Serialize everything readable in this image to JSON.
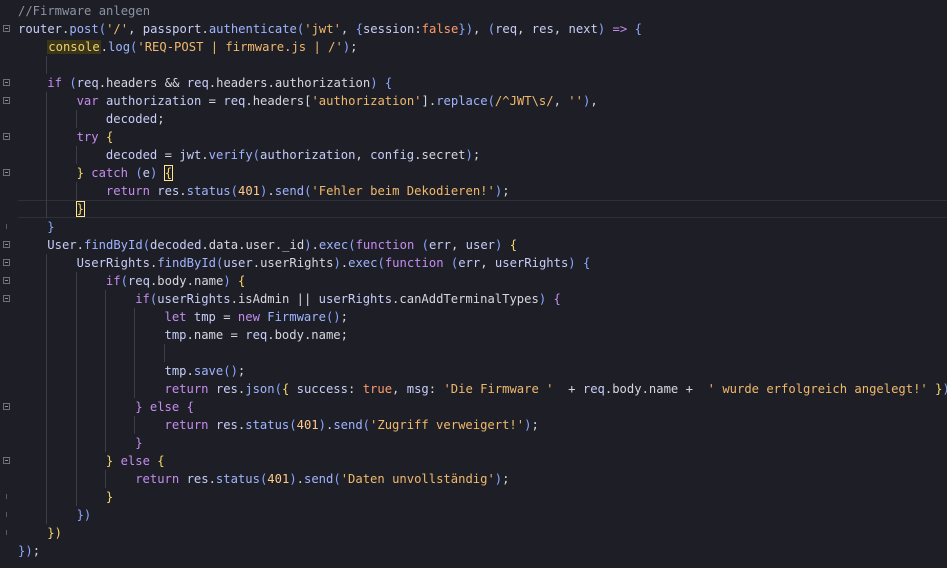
{
  "editor": {
    "theme": {
      "background": "#1e1f26",
      "comment": "#8b93a3",
      "string": "#f0b86d",
      "keyword": "#c58cf0",
      "function": "#9fb4ff",
      "variable": "#c6cdf7"
    },
    "lines": [
      {
        "indent": 0,
        "tokens": [
          [
            "comment",
            "//Firmware anlegen"
          ]
        ]
      },
      {
        "indent": 0,
        "fold": true,
        "tokens": [
          [
            "var",
            "router"
          ],
          [
            "punc",
            "."
          ],
          [
            "fn",
            "post"
          ],
          [
            "paren",
            "("
          ],
          [
            "str",
            "'/'"
          ],
          [
            "punc",
            ", "
          ],
          [
            "var",
            "passport"
          ],
          [
            "punc",
            "."
          ],
          [
            "fn",
            "authenticate"
          ],
          [
            "paren",
            "("
          ],
          [
            "str",
            "'jwt'"
          ],
          [
            "punc",
            ", "
          ],
          [
            "paren",
            "{"
          ],
          [
            "var",
            "session"
          ],
          [
            "punc",
            ":"
          ],
          [
            "bool",
            "false"
          ],
          [
            "paren",
            "}"
          ],
          [
            "paren",
            ")"
          ],
          [
            "punc",
            ", "
          ],
          [
            "paren",
            "("
          ],
          [
            "var",
            "req"
          ],
          [
            "punc",
            ", "
          ],
          [
            "var",
            "res"
          ],
          [
            "punc",
            ", "
          ],
          [
            "var",
            "next"
          ],
          [
            "paren",
            ")"
          ],
          [
            "punc",
            " "
          ],
          [
            "kw",
            "=>"
          ],
          [
            "punc",
            " "
          ],
          [
            "paren",
            "{"
          ]
        ]
      },
      {
        "indent": 1,
        "tokens": [
          [
            "console",
            "console"
          ],
          [
            "punc",
            "."
          ],
          [
            "fn",
            "log"
          ],
          [
            "paren",
            "("
          ],
          [
            "str",
            "'REQ-POST | firmware.js | /'"
          ],
          [
            "paren",
            ")"
          ],
          [
            "punc",
            ";"
          ]
        ]
      },
      {
        "indent": 1,
        "tokens": []
      },
      {
        "indent": 1,
        "fold": true,
        "tokens": [
          [
            "kw",
            "if"
          ],
          [
            "punc",
            " "
          ],
          [
            "paren",
            "("
          ],
          [
            "var",
            "req"
          ],
          [
            "punc",
            "."
          ],
          [
            "prop",
            "headers"
          ],
          [
            "punc",
            " && "
          ],
          [
            "var",
            "req"
          ],
          [
            "punc",
            "."
          ],
          [
            "prop",
            "headers"
          ],
          [
            "punc",
            "."
          ],
          [
            "prop",
            "authorization"
          ],
          [
            "paren",
            ")"
          ],
          [
            "punc",
            " "
          ],
          [
            "paren",
            "{"
          ]
        ]
      },
      {
        "indent": 2,
        "fold": true,
        "tokens": [
          [
            "kw",
            "var"
          ],
          [
            "punc",
            " "
          ],
          [
            "var",
            "authorization"
          ],
          [
            "punc",
            " = "
          ],
          [
            "var",
            "req"
          ],
          [
            "punc",
            "."
          ],
          [
            "prop",
            "headers"
          ],
          [
            "punc",
            "["
          ],
          [
            "str",
            "'authorization'"
          ],
          [
            "punc",
            "]."
          ],
          [
            "fn",
            "replace"
          ],
          [
            "paren",
            "("
          ],
          [
            "str",
            "/^JWT\\s/"
          ],
          [
            "punc",
            ", "
          ],
          [
            "str",
            "''"
          ],
          [
            "paren",
            ")"
          ],
          [
            "punc",
            ","
          ]
        ]
      },
      {
        "indent": 3,
        "tokens": [
          [
            "var",
            "decoded"
          ],
          [
            "punc",
            ";"
          ]
        ]
      },
      {
        "indent": 2,
        "fold": true,
        "tokens": [
          [
            "kw",
            "try"
          ],
          [
            "punc",
            " "
          ],
          [
            "ok",
            "{"
          ]
        ]
      },
      {
        "indent": 3,
        "tokens": [
          [
            "var",
            "decoded"
          ],
          [
            "punc",
            " = "
          ],
          [
            "var",
            "jwt"
          ],
          [
            "punc",
            "."
          ],
          [
            "fn",
            "verify"
          ],
          [
            "paren",
            "("
          ],
          [
            "var",
            "authorization"
          ],
          [
            "punc",
            ", "
          ],
          [
            "var",
            "config"
          ],
          [
            "punc",
            "."
          ],
          [
            "prop",
            "secret"
          ],
          [
            "paren",
            ")"
          ],
          [
            "punc",
            ";"
          ]
        ]
      },
      {
        "indent": 2,
        "fold": true,
        "tokens": [
          [
            "ok",
            "}"
          ],
          [
            "punc",
            " "
          ],
          [
            "kw",
            "catch"
          ],
          [
            "punc",
            " "
          ],
          [
            "paren",
            "("
          ],
          [
            "var",
            "e"
          ],
          [
            "paren",
            ")"
          ],
          [
            "punc",
            " "
          ],
          [
            "hl",
            "{"
          ]
        ]
      },
      {
        "indent": 3,
        "tokens": [
          [
            "kw",
            "return"
          ],
          [
            "punc",
            " "
          ],
          [
            "var",
            "res"
          ],
          [
            "punc",
            "."
          ],
          [
            "fn",
            "status"
          ],
          [
            "paren",
            "("
          ],
          [
            "num",
            "401"
          ],
          [
            "paren",
            ")"
          ],
          [
            "punc",
            "."
          ],
          [
            "fn",
            "send"
          ],
          [
            "paren",
            "("
          ],
          [
            "str",
            "'Fehler beim Dekodieren!'"
          ],
          [
            "paren",
            ")"
          ],
          [
            "punc",
            ";"
          ]
        ]
      },
      {
        "indent": 2,
        "cursor": true,
        "tokens": [
          [
            "hl",
            "}"
          ]
        ]
      },
      {
        "indent": 1,
        "tokens": [
          [
            "paren",
            "}"
          ]
        ]
      },
      {
        "indent": 1,
        "fold": true,
        "tokens": [
          [
            "var",
            "User"
          ],
          [
            "punc",
            "."
          ],
          [
            "fn",
            "findById"
          ],
          [
            "paren",
            "("
          ],
          [
            "var",
            "decoded"
          ],
          [
            "punc",
            "."
          ],
          [
            "prop",
            "data"
          ],
          [
            "punc",
            "."
          ],
          [
            "prop",
            "user"
          ],
          [
            "punc",
            "."
          ],
          [
            "prop",
            "_id"
          ],
          [
            "paren",
            ")"
          ],
          [
            "punc",
            "."
          ],
          [
            "fn",
            "exec"
          ],
          [
            "paren",
            "("
          ],
          [
            "kw",
            "function"
          ],
          [
            "punc",
            " "
          ],
          [
            "paren",
            "("
          ],
          [
            "var",
            "err"
          ],
          [
            "punc",
            ", "
          ],
          [
            "var",
            "user"
          ],
          [
            "paren",
            ")"
          ],
          [
            "punc",
            " "
          ],
          [
            "ok",
            "{"
          ]
        ]
      },
      {
        "indent": 2,
        "fold": true,
        "tokens": [
          [
            "var",
            "UserRights"
          ],
          [
            "punc",
            "."
          ],
          [
            "fn",
            "findById"
          ],
          [
            "paren",
            "("
          ],
          [
            "var",
            "user"
          ],
          [
            "punc",
            "."
          ],
          [
            "prop",
            "userRights"
          ],
          [
            "paren",
            ")"
          ],
          [
            "punc",
            "."
          ],
          [
            "fn",
            "exec"
          ],
          [
            "paren",
            "("
          ],
          [
            "kw",
            "function"
          ],
          [
            "punc",
            " "
          ],
          [
            "paren",
            "("
          ],
          [
            "var",
            "err"
          ],
          [
            "punc",
            ", "
          ],
          [
            "var",
            "userRights"
          ],
          [
            "paren",
            ")"
          ],
          [
            "punc",
            " "
          ],
          [
            "paren",
            "{"
          ]
        ]
      },
      {
        "indent": 3,
        "fold": true,
        "tokens": [
          [
            "kw",
            "if"
          ],
          [
            "paren",
            "("
          ],
          [
            "var",
            "req"
          ],
          [
            "punc",
            "."
          ],
          [
            "prop",
            "body"
          ],
          [
            "punc",
            "."
          ],
          [
            "prop",
            "name"
          ],
          [
            "paren",
            ")"
          ],
          [
            "punc",
            " "
          ],
          [
            "ok",
            "{"
          ]
        ]
      },
      {
        "indent": 4,
        "fold": true,
        "tokens": [
          [
            "kw",
            "if"
          ],
          [
            "paren",
            "("
          ],
          [
            "var",
            "userRights"
          ],
          [
            "punc",
            "."
          ],
          [
            "prop",
            "isAdmin"
          ],
          [
            "punc",
            " || "
          ],
          [
            "var",
            "userRights"
          ],
          [
            "punc",
            "."
          ],
          [
            "prop",
            "canAddTerminalTypes"
          ],
          [
            "paren",
            ")"
          ],
          [
            "punc",
            " "
          ],
          [
            "kw",
            "{"
          ]
        ]
      },
      {
        "indent": 5,
        "tokens": [
          [
            "kw",
            "let"
          ],
          [
            "punc",
            " "
          ],
          [
            "var",
            "tmp"
          ],
          [
            "punc",
            " = "
          ],
          [
            "kw",
            "new"
          ],
          [
            "punc",
            " "
          ],
          [
            "fn",
            "Firmware"
          ],
          [
            "paren",
            "("
          ],
          [
            "paren",
            ")"
          ],
          [
            "punc",
            ";"
          ]
        ]
      },
      {
        "indent": 5,
        "tokens": [
          [
            "var",
            "tmp"
          ],
          [
            "punc",
            "."
          ],
          [
            "prop",
            "name"
          ],
          [
            "punc",
            " = "
          ],
          [
            "var",
            "req"
          ],
          [
            "punc",
            "."
          ],
          [
            "prop",
            "body"
          ],
          [
            "punc",
            "."
          ],
          [
            "prop",
            "name"
          ],
          [
            "punc",
            ";"
          ]
        ]
      },
      {
        "indent": 5,
        "tokens": []
      },
      {
        "indent": 5,
        "tokens": [
          [
            "var",
            "tmp"
          ],
          [
            "punc",
            "."
          ],
          [
            "fn",
            "save"
          ],
          [
            "paren",
            "("
          ],
          [
            "paren",
            ")"
          ],
          [
            "punc",
            ";"
          ]
        ]
      },
      {
        "indent": 5,
        "tokens": [
          [
            "kw",
            "return"
          ],
          [
            "punc",
            " "
          ],
          [
            "var",
            "res"
          ],
          [
            "punc",
            "."
          ],
          [
            "fn",
            "json"
          ],
          [
            "paren",
            "("
          ],
          [
            "ok",
            "{"
          ],
          [
            "punc",
            " "
          ],
          [
            "var",
            "success"
          ],
          [
            "punc",
            ": "
          ],
          [
            "bool",
            "true"
          ],
          [
            "punc",
            ", "
          ],
          [
            "var",
            "msg"
          ],
          [
            "punc",
            ": "
          ],
          [
            "str",
            "'Die Firmware '"
          ],
          [
            "punc",
            "  + "
          ],
          [
            "var",
            "req"
          ],
          [
            "punc",
            "."
          ],
          [
            "prop",
            "body"
          ],
          [
            "punc",
            "."
          ],
          [
            "prop",
            "name"
          ],
          [
            "punc",
            " +  "
          ],
          [
            "str",
            "' wurde erfolgreich angelegt!'"
          ],
          [
            "punc",
            " "
          ],
          [
            "ok",
            "}"
          ],
          [
            "paren",
            ")"
          ],
          [
            "punc",
            ";"
          ]
        ]
      },
      {
        "indent": 4,
        "fold": true,
        "tokens": [
          [
            "kw",
            "}"
          ],
          [
            "punc",
            " "
          ],
          [
            "kw",
            "else"
          ],
          [
            "punc",
            " "
          ],
          [
            "kw",
            "{"
          ]
        ]
      },
      {
        "indent": 5,
        "tokens": [
          [
            "kw",
            "return"
          ],
          [
            "punc",
            " "
          ],
          [
            "var",
            "res"
          ],
          [
            "punc",
            "."
          ],
          [
            "fn",
            "status"
          ],
          [
            "paren",
            "("
          ],
          [
            "num",
            "401"
          ],
          [
            "paren",
            ")"
          ],
          [
            "punc",
            "."
          ],
          [
            "fn",
            "send"
          ],
          [
            "paren",
            "("
          ],
          [
            "str",
            "'Zugriff verweigert!'"
          ],
          [
            "paren",
            ")"
          ],
          [
            "punc",
            ";"
          ]
        ]
      },
      {
        "indent": 4,
        "tokens": [
          [
            "kw",
            "}"
          ]
        ]
      },
      {
        "indent": 3,
        "fold": true,
        "tokens": [
          [
            "ok",
            "}"
          ],
          [
            "punc",
            " "
          ],
          [
            "kw",
            "else"
          ],
          [
            "punc",
            " "
          ],
          [
            "ok",
            "{"
          ]
        ]
      },
      {
        "indent": 4,
        "tokens": [
          [
            "kw",
            "return"
          ],
          [
            "punc",
            " "
          ],
          [
            "var",
            "res"
          ],
          [
            "punc",
            "."
          ],
          [
            "fn",
            "status"
          ],
          [
            "paren",
            "("
          ],
          [
            "num",
            "401"
          ],
          [
            "paren",
            ")"
          ],
          [
            "punc",
            "."
          ],
          [
            "fn",
            "send"
          ],
          [
            "paren",
            "("
          ],
          [
            "str",
            "'Daten unvollständig'"
          ],
          [
            "paren",
            ")"
          ],
          [
            "punc",
            ";"
          ]
        ]
      },
      {
        "indent": 3,
        "tokens": [
          [
            "ok",
            "}"
          ]
        ]
      },
      {
        "indent": 2,
        "tokens": [
          [
            "paren",
            "})"
          ]
        ]
      },
      {
        "indent": 1,
        "tokens": [
          [
            "ok",
            "})"
          ]
        ]
      },
      {
        "indent": 0,
        "tokens": [
          [
            "paren",
            "}"
          ],
          [
            "paren",
            ")"
          ],
          [
            "punc",
            ";"
          ]
        ]
      }
    ]
  }
}
